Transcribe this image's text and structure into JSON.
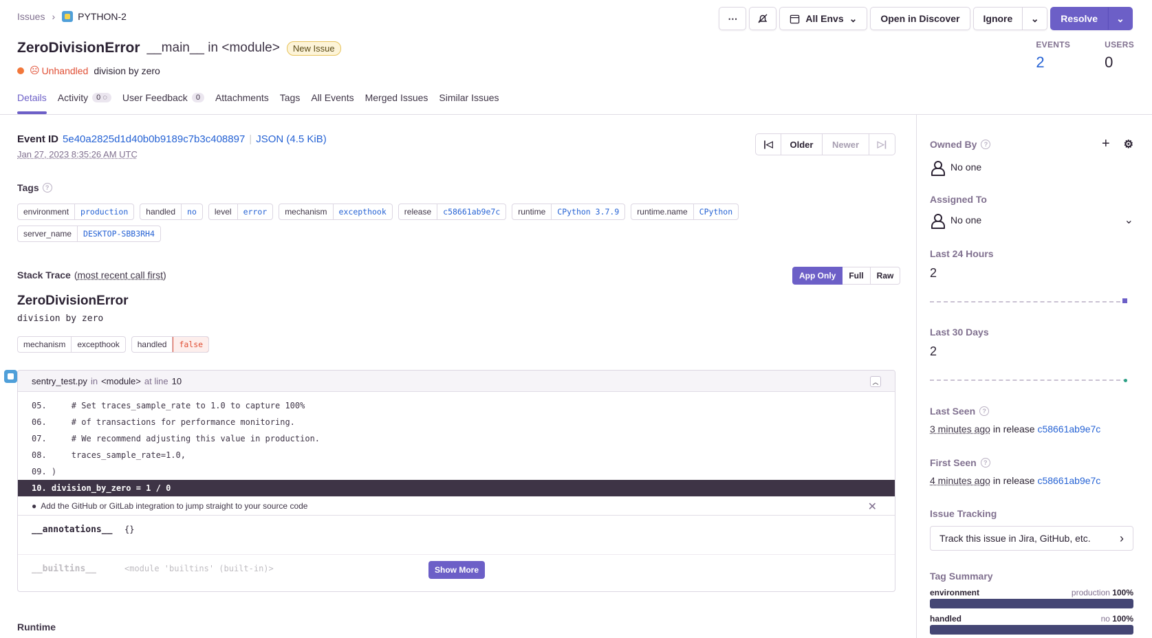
{
  "breadcrumb": {
    "root": "Issues",
    "project": "PYTHON-2"
  },
  "header_actions": {
    "more": "⋯",
    "env": "All Envs",
    "discover": "Open in Discover",
    "ignore": "Ignore",
    "resolve": "Resolve"
  },
  "issue": {
    "type": "ZeroDivisionError",
    "culprit": "__main__ in <module>",
    "badge": "New Issue",
    "unhandled": "Unhandled",
    "message": "division by zero"
  },
  "stats": {
    "events_label": "EVENTS",
    "events": "2",
    "users_label": "USERS",
    "users": "0"
  },
  "tabs": [
    {
      "label": "Details"
    },
    {
      "label": "Activity",
      "count": "0"
    },
    {
      "label": "User Feedback",
      "count": "0"
    },
    {
      "label": "Attachments"
    },
    {
      "label": "Tags"
    },
    {
      "label": "All Events"
    },
    {
      "label": "Merged Issues"
    },
    {
      "label": "Similar Issues"
    }
  ],
  "event": {
    "id_label": "Event ID",
    "id": "5e40a2825d1d40b0b9189c7b3c408897",
    "json": "JSON (4.5 KiB)",
    "date": "Jan 27, 2023 8:35:26 AM UTC",
    "older": "Older",
    "newer": "Newer"
  },
  "tags_section": {
    "title": "Tags",
    "items": [
      {
        "key": "environment",
        "value": "production"
      },
      {
        "key": "handled",
        "value": "no"
      },
      {
        "key": "level",
        "value": "error"
      },
      {
        "key": "mechanism",
        "value": "excepthook"
      },
      {
        "key": "release",
        "value": "c58661ab9e7c"
      },
      {
        "key": "runtime",
        "value": "CPython 3.7.9"
      },
      {
        "key": "runtime.name",
        "value": "CPython"
      },
      {
        "key": "server_name",
        "value": "DESKTOP-SBB3RH4"
      }
    ]
  },
  "stack": {
    "title": "Stack Trace",
    "order": "most recent call first",
    "modes": [
      "App Only",
      "Full",
      "Raw"
    ],
    "exception": "ZeroDivisionError",
    "value": "division by zero",
    "mechanism": [
      {
        "key": "mechanism",
        "value": "excepthook"
      },
      {
        "key": "handled",
        "value": "false"
      }
    ],
    "frame": {
      "file": "sentry_test.py",
      "in": "in",
      "function": "<module>",
      "at_line": "at line",
      "line": "10"
    },
    "code": [
      "05.     # Set traces_sample_rate to 1.0 to capture 100%",
      "06.     # of transactions for performance monitoring.",
      "07.     # We recommend adjusting this value in production.",
      "08.     traces_sample_rate=1.0,",
      "09. )",
      "10. division_by_zero = 1 / 0"
    ],
    "integration_hint": "Add the GitHub or GitLab integration to jump straight to your source code",
    "vars": [
      {
        "key": "__annotations__",
        "value": "{}"
      },
      {
        "key": "__builtins__",
        "value": "<module 'builtins' (built-in)>"
      }
    ],
    "show_more": "Show More"
  },
  "runtime_title": "Runtime",
  "sidebar": {
    "owned_by": "Owned By",
    "owner": "No one",
    "assigned_to": "Assigned To",
    "assignee": "No one",
    "last24_label": "Last 24 Hours",
    "last24": "2",
    "last30_label": "Last 30 Days",
    "last30": "2",
    "last_seen_label": "Last Seen",
    "last_seen": "3 minutes ago",
    "first_seen_label": "First Seen",
    "first_seen": "4 minutes ago",
    "in_release": "in release",
    "release": "c58661ab9e7c",
    "tracking_label": "Issue Tracking",
    "tracking": "Track this issue in Jira, GitHub, etc.",
    "tag_summary": "Tag Summary",
    "summary": [
      {
        "key": "environment",
        "top": "production",
        "pct": "100%"
      },
      {
        "key": "handled",
        "top": "no",
        "pct": "100%"
      }
    ]
  }
}
